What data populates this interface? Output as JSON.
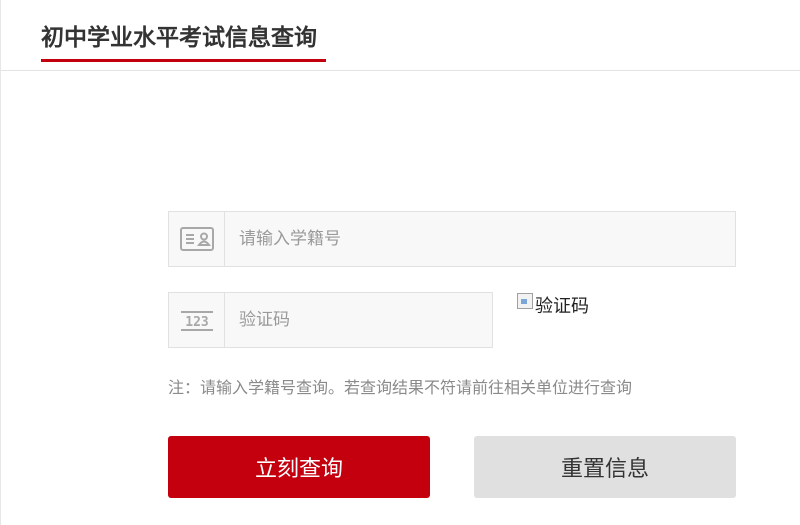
{
  "header": {
    "title": "初中学业水平考试信息查询",
    "accent_color": "#c4000f"
  },
  "form": {
    "student_id": {
      "icon": "id-card-icon",
      "placeholder": "请输入学籍号",
      "value": ""
    },
    "captcha": {
      "icon": "number-123-icon",
      "placeholder": "验证码",
      "value": "",
      "image_alt": "验证码"
    },
    "note": "注：请输入学籍号查询。若查询结果不符请前往相关单位进行查询"
  },
  "buttons": {
    "query_label": "立刻查询",
    "reset_label": "重置信息",
    "query_color": "#c4000f",
    "reset_color": "#e0e0e0"
  }
}
